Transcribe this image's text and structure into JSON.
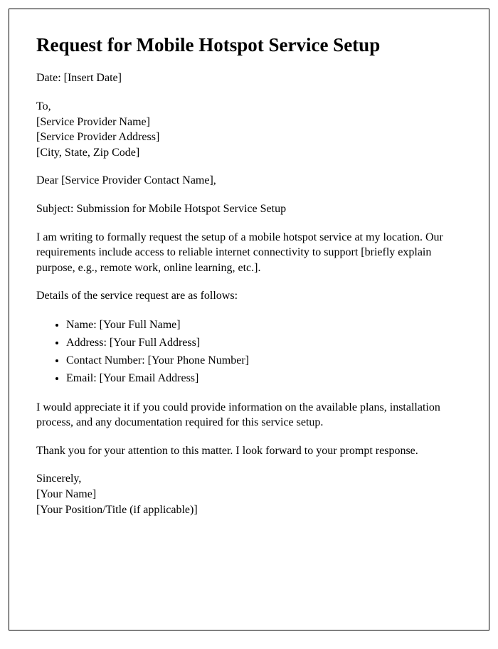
{
  "title": "Request for Mobile Hotspot Service Setup",
  "date_line": "Date: [Insert Date]",
  "to_block": {
    "line1": "To,",
    "line2": "[Service Provider Name]",
    "line3": "[Service Provider Address]",
    "line4": "[City, State, Zip Code]"
  },
  "salutation": "Dear [Service Provider Contact Name],",
  "subject": "Subject: Submission for Mobile Hotspot Service Setup",
  "body1": "I am writing to formally request the setup of a mobile hotspot service at my location. Our requirements include access to reliable internet connectivity to support [briefly explain purpose, e.g., remote work, online learning, etc.].",
  "details_intro": "Details of the service request are as follows:",
  "details": {
    "item1": "Name: [Your Full Name]",
    "item2": "Address: [Your Full Address]",
    "item3": "Contact Number: [Your Phone Number]",
    "item4": "Email: [Your Email Address]"
  },
  "body2": "I would appreciate it if you could provide information on the available plans, installation process, and any documentation required for this service setup.",
  "body3": "Thank you for your attention to this matter. I look forward to your prompt response.",
  "closing": {
    "line1": "Sincerely,",
    "line2": "[Your Name]",
    "line3": "[Your Position/Title (if applicable)]"
  }
}
